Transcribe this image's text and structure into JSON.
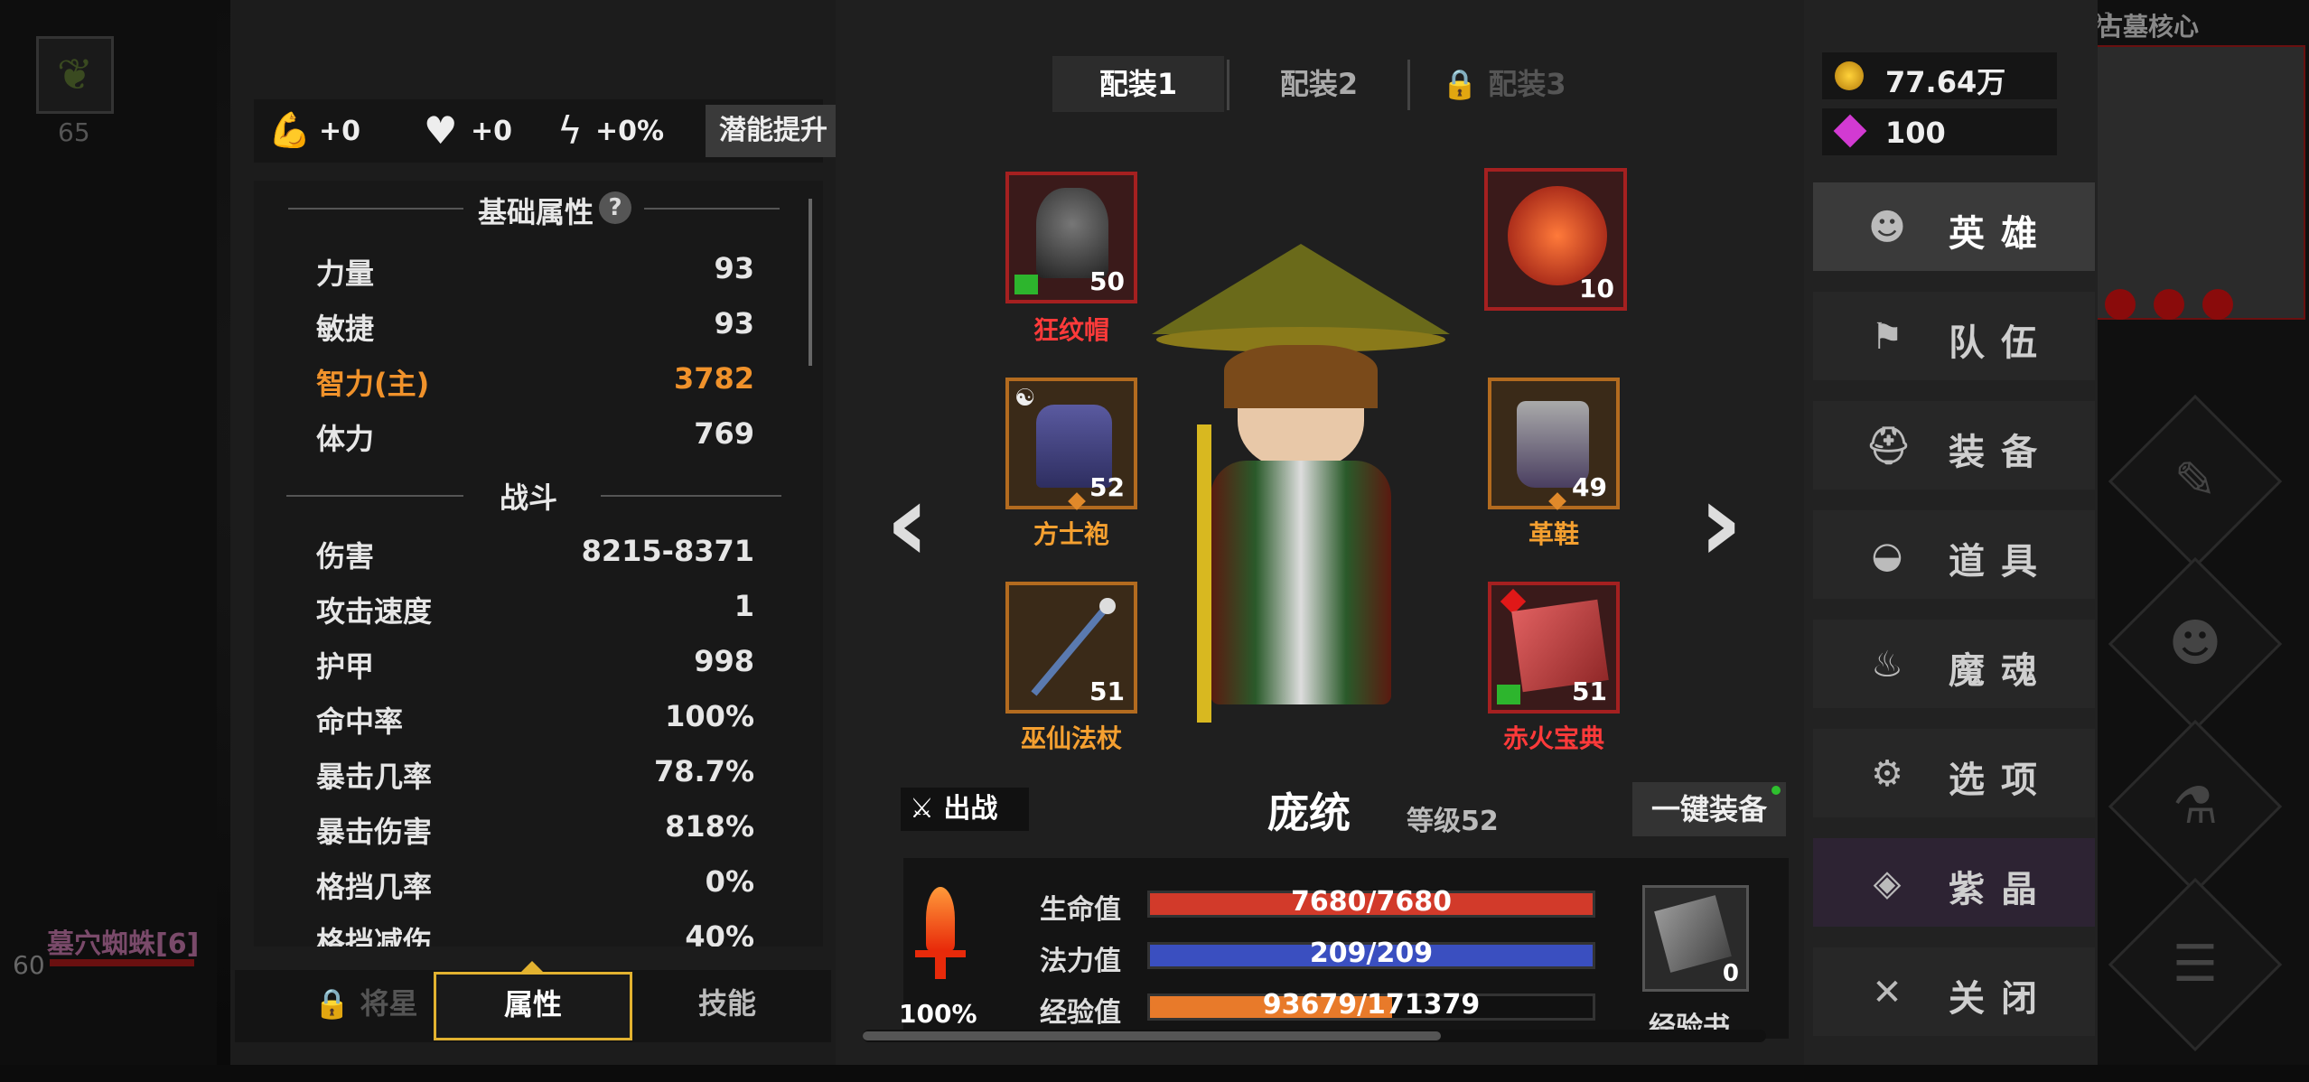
{
  "session_id": "[a4dcd37b-05fb-45f5-98e9]",
  "location": "古墓核心",
  "background": {
    "left_number": "65",
    "enemy_name": "墓穴蜘蛛[6]",
    "enemy_number": "60"
  },
  "bonuses": {
    "strength": "+0",
    "health": "+0",
    "speed": "+0%",
    "potential_button": "潜能提升"
  },
  "basic_attrs": {
    "title": "基础属性",
    "help": "?",
    "rows": [
      {
        "label": "力量",
        "value": "93"
      },
      {
        "label": "敏捷",
        "value": "93"
      },
      {
        "label": "智力(主)",
        "value": "3782"
      },
      {
        "label": "体力",
        "value": "769"
      }
    ]
  },
  "combat": {
    "title": "战斗",
    "rows": [
      {
        "label": "伤害",
        "value": "8215-8371"
      },
      {
        "label": "攻击速度",
        "value": "1"
      },
      {
        "label": "护甲",
        "value": "998"
      },
      {
        "label": "命中率",
        "value": "100%"
      },
      {
        "label": "暴击几率",
        "value": "78.7%"
      },
      {
        "label": "暴击伤害",
        "value": "818%"
      },
      {
        "label": "格挡几率",
        "value": "0%"
      },
      {
        "label": "格挡减伤",
        "value": "40%"
      }
    ]
  },
  "bottom_tabs": [
    "将星",
    "属性",
    "技能"
  ],
  "loadout_tabs": [
    "配装1",
    "配装2",
    "配装3"
  ],
  "equipment": [
    {
      "name": "狂纹帽",
      "level": "50"
    },
    {
      "name": "方士袍",
      "level": "52"
    },
    {
      "name": "巫仙法杖",
      "level": "51"
    },
    {
      "name": "",
      "level": "10"
    },
    {
      "name": "革鞋",
      "level": "49"
    },
    {
      "name": "赤火宝典",
      "level": "51"
    }
  ],
  "nav_arrows": {
    "prev": "‹",
    "next": "›"
  },
  "hero": {
    "deploy_label": "出战",
    "name": "庞统",
    "level": "等级52",
    "auto_equip": "一键装备"
  },
  "power": {
    "percent": "100%"
  },
  "bars": {
    "hp": {
      "label": "生命值",
      "text": "7680/7680",
      "fraction": 1.0
    },
    "mp": {
      "label": "法力值",
      "text": "209/209",
      "fraction": 1.0
    },
    "exp": {
      "label": "经验值",
      "text": "93679/171379",
      "fraction": 0.5466
    }
  },
  "exp_book": {
    "label": "经验书",
    "count": "0"
  },
  "currency": {
    "gold": "77.64万",
    "gems": "100"
  },
  "menu": [
    "英雄",
    "队伍",
    "装备",
    "道具",
    "魔魂",
    "选项",
    "紫晶",
    "关闭"
  ],
  "colors": {
    "accent_orange": "#f0922b",
    "item_red": "#ff3a3a",
    "hp_bar": "#d23a2a",
    "mp_bar": "#3a4fc0",
    "exp_bar": "#e87a2a",
    "selected_tab": "#e2b230"
  }
}
